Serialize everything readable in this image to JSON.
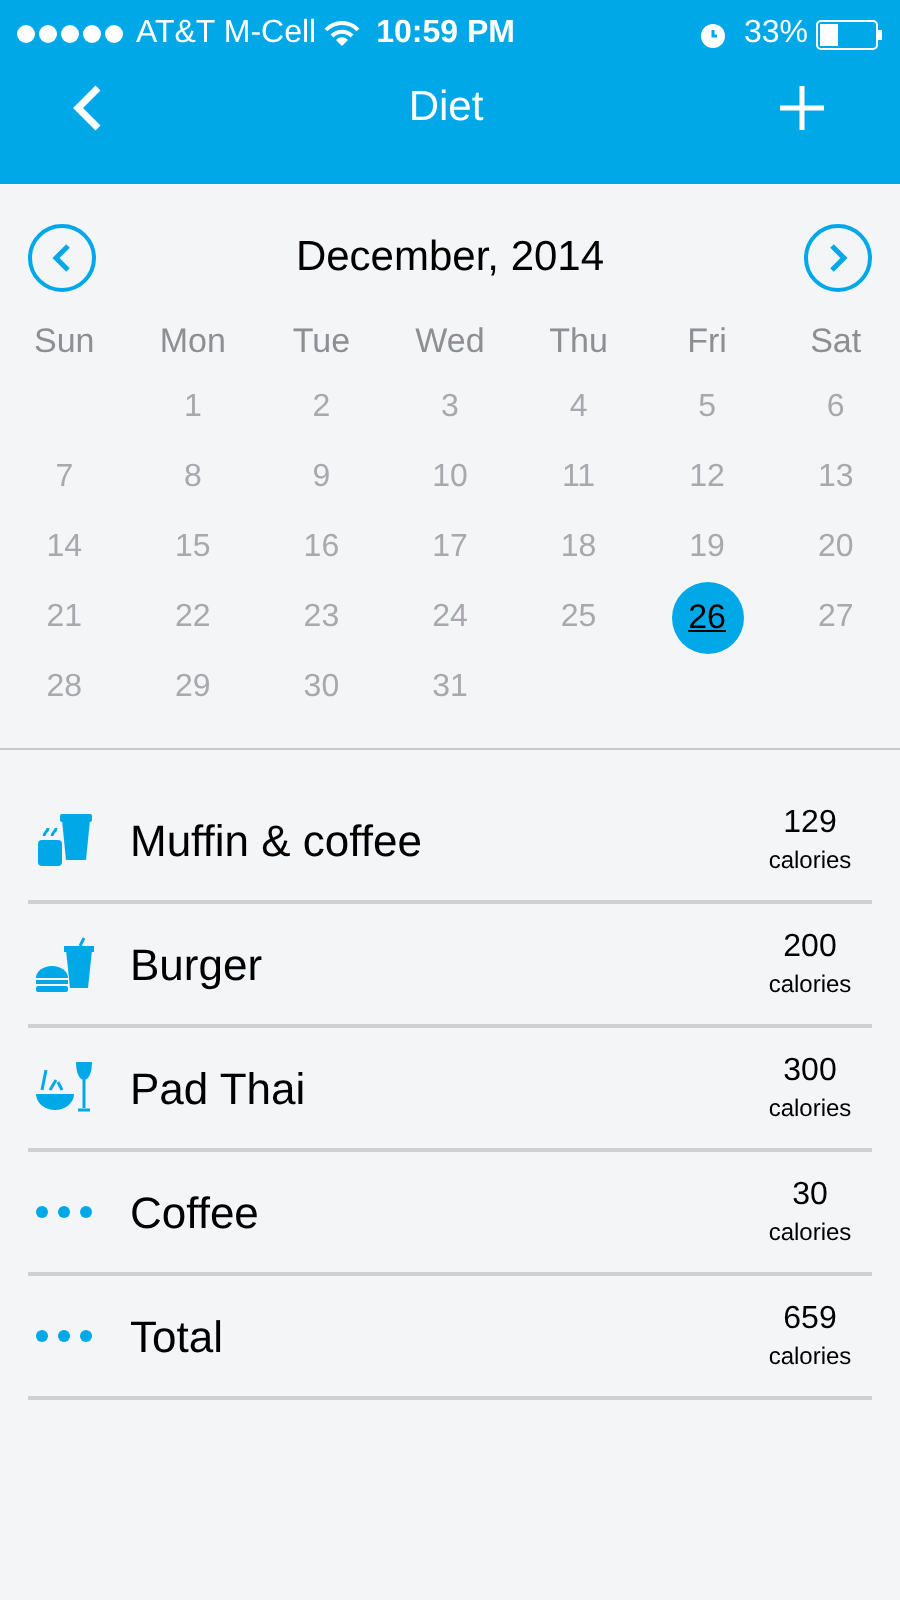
{
  "status_bar": {
    "carrier": "AT&T M-Cell",
    "time": "10:59 PM",
    "battery": "33%"
  },
  "nav": {
    "title": "Diet"
  },
  "calendar": {
    "month": "December, 2014",
    "weekdays": [
      "Sun",
      "Mon",
      "Tue",
      "Wed",
      "Thu",
      "Fri",
      "Sat"
    ],
    "weeks": [
      [
        {
          "label": "1",
          "selected": false
        },
        {
          "label": "2",
          "selected": false
        },
        {
          "label": "3",
          "selected": false
        },
        {
          "label": "4",
          "selected": false
        },
        {
          "label": "5",
          "selected": false
        },
        {
          "label": "6",
          "selected": false
        }
      ],
      [
        {
          "label": "7",
          "selected": false
        },
        {
          "label": "8",
          "selected": false
        },
        {
          "label": "9",
          "selected": false
        },
        {
          "label": "10",
          "selected": false
        },
        {
          "label": "11",
          "selected": false
        },
        {
          "label": "12",
          "selected": false
        },
        {
          "label": "13",
          "selected": false
        }
      ],
      [
        {
          "label": "14",
          "selected": false
        },
        {
          "label": "15",
          "selected": false
        },
        {
          "label": "16",
          "selected": false
        },
        {
          "label": "17",
          "selected": false
        },
        {
          "label": "18",
          "selected": false
        },
        {
          "label": "19",
          "selected": false
        },
        {
          "label": "20",
          "selected": false
        }
      ],
      [
        {
          "label": "21",
          "selected": false
        },
        {
          "label": "22",
          "selected": false
        },
        {
          "label": "23",
          "selected": false
        },
        {
          "label": "24",
          "selected": false
        },
        {
          "label": "25",
          "selected": false
        },
        {
          "label": "26",
          "selected": true
        },
        {
          "label": "27",
          "selected": false
        }
      ],
      [
        {
          "label": "28",
          "selected": false
        },
        {
          "label": "29",
          "selected": false
        },
        {
          "label": "30",
          "selected": false
        },
        {
          "label": "31",
          "selected": false
        }
      ]
    ]
  },
  "meals": [
    {
      "kind": "breakfast",
      "name": "Muffin & coffee",
      "calories": "129",
      "unit": "calories"
    },
    {
      "kind": "lunch",
      "name": "Burger",
      "calories": "200",
      "unit": "calories"
    },
    {
      "kind": "dinner",
      "name": "Pad Thai",
      "calories": "300",
      "unit": "calories"
    },
    {
      "kind": "other",
      "name": "Coffee",
      "calories": "30",
      "unit": "calories"
    },
    {
      "kind": "other",
      "name": "Total",
      "calories": "659",
      "unit": "calories"
    }
  ]
}
